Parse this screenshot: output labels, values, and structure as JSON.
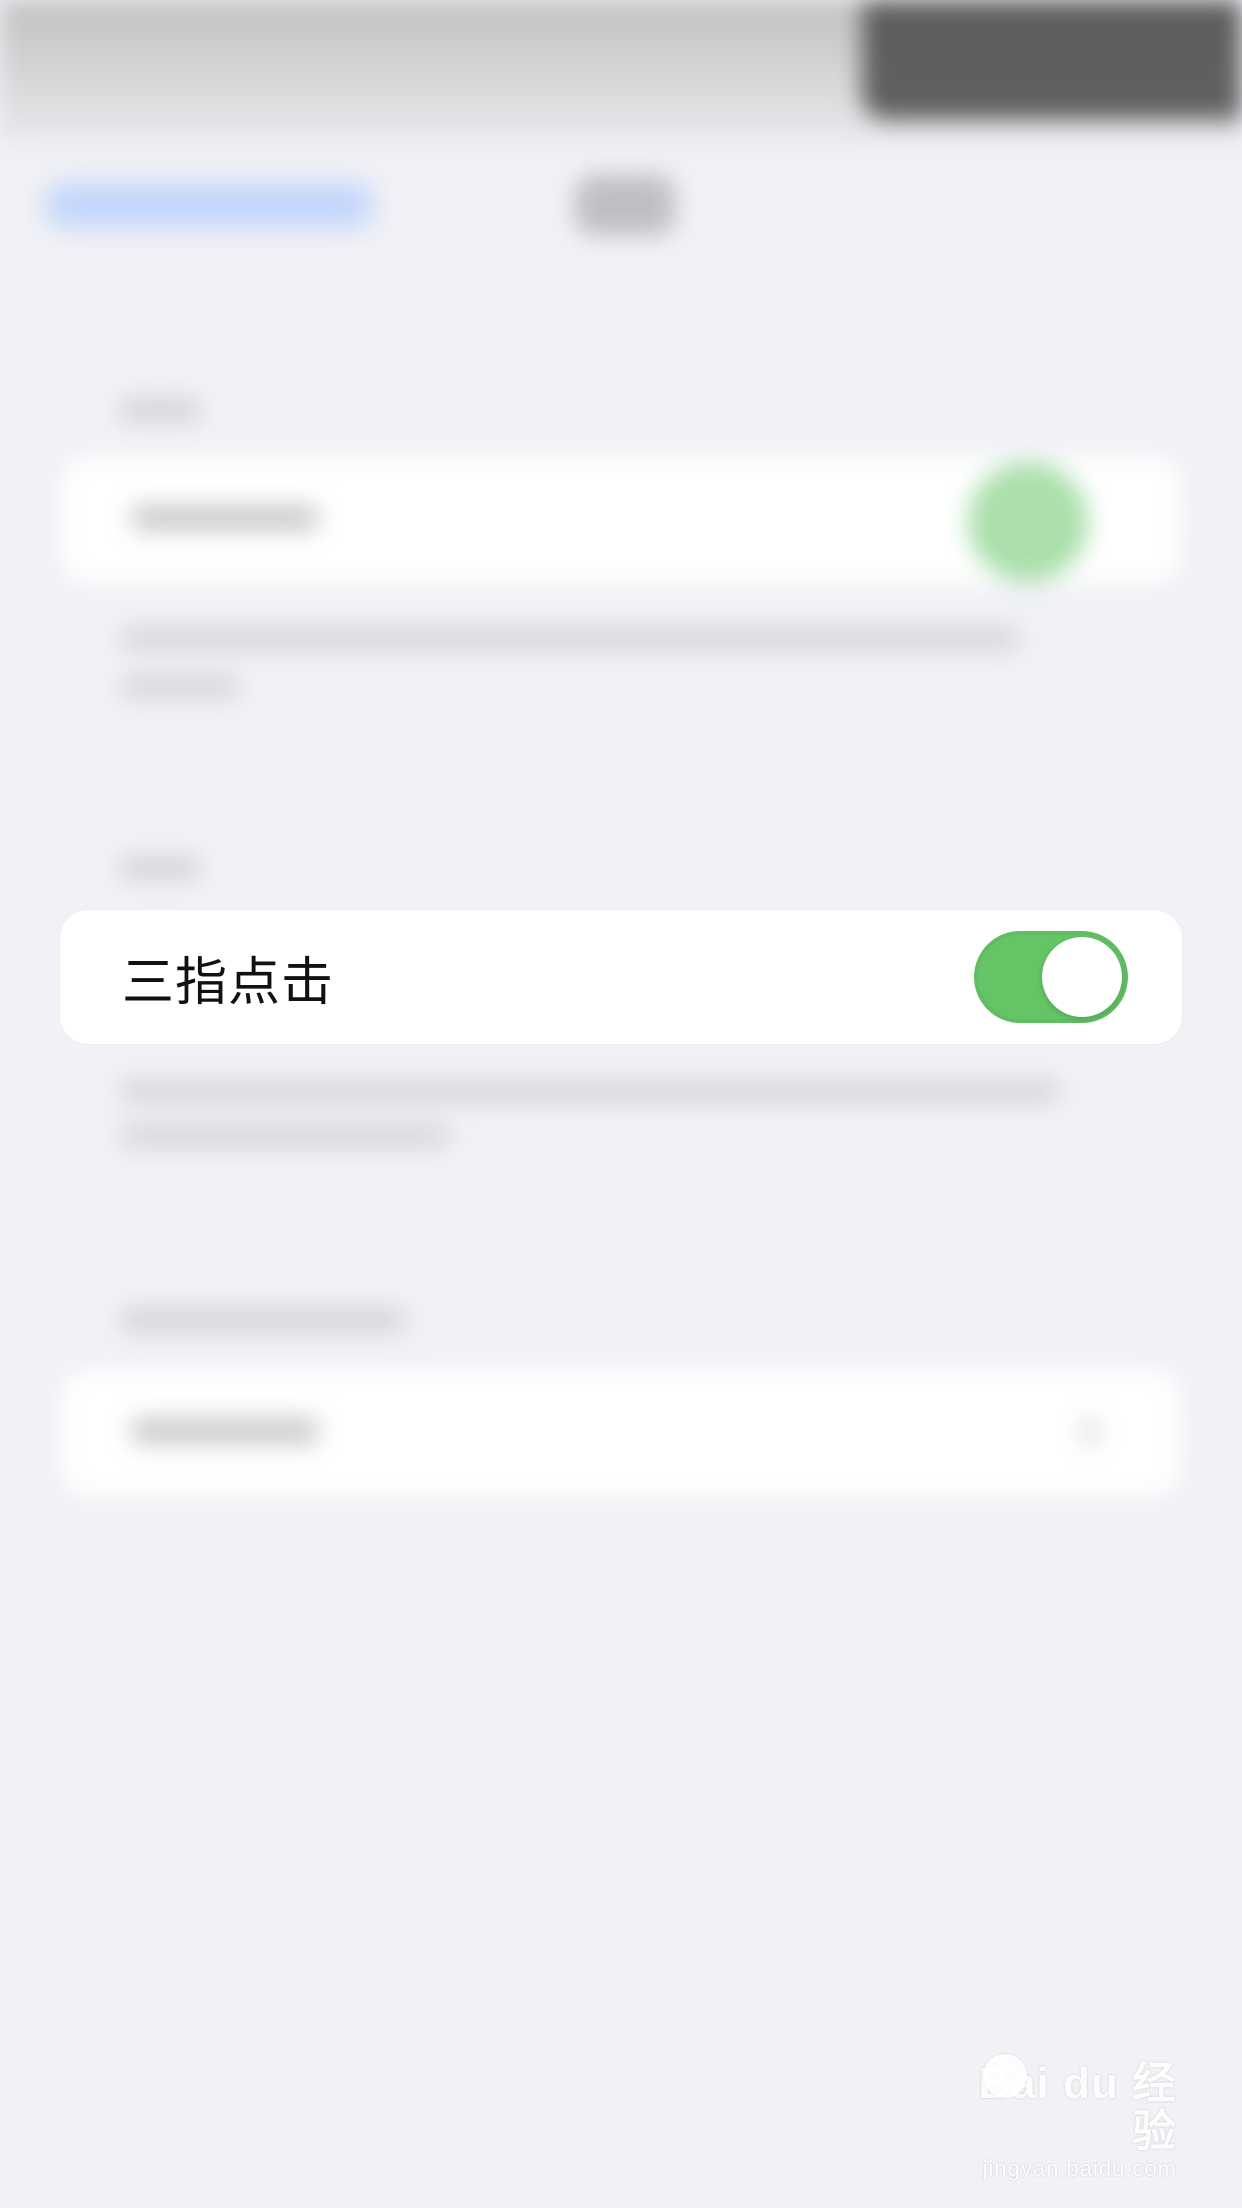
{
  "row": {
    "label": "三指点击",
    "toggle_on": true
  },
  "watermark": {
    "brand": "Bai du 经验",
    "url": "jingyan.baidu.com"
  },
  "colors": {
    "background": "#f1f1f6",
    "toggle_on": "#65c466",
    "card": "#ffffff",
    "text": "#111111"
  }
}
